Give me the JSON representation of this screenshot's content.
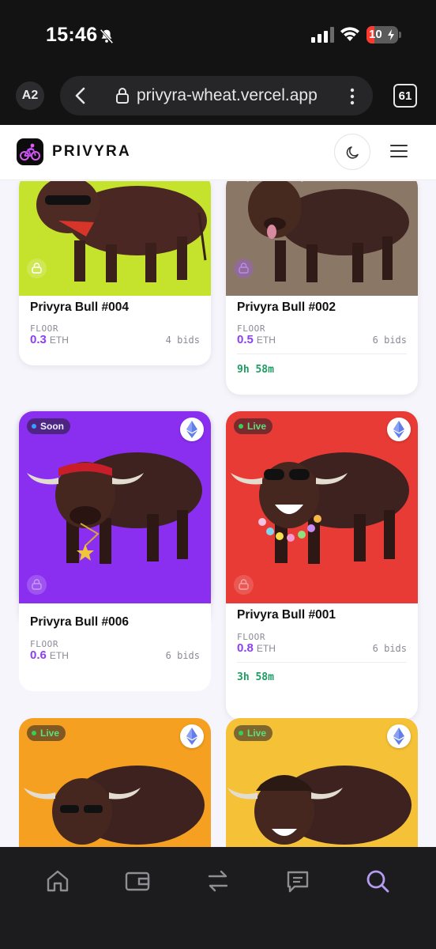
{
  "status_bar": {
    "time": "15:46",
    "battery": "10"
  },
  "browser": {
    "profile": "A2",
    "url": "privyra-wheat.vercel.app",
    "tab_count": "61"
  },
  "header": {
    "brand": "PRIVYRA"
  },
  "cards": [
    {
      "title": "Privyra Bull #004",
      "floor_label": "FLOOR",
      "floor_value": "0.3",
      "floor_unit": "ETH",
      "bids": "4 bids"
    },
    {
      "title": "Privyra Bull #002",
      "floor_label": "FLOOR",
      "floor_value": "0.5",
      "floor_unit": "ETH",
      "bids": "6 bids",
      "timer": "9h 58m"
    },
    {
      "badge": "Soon",
      "title": "Privyra Bull #006",
      "floor_label": "FLOOR",
      "floor_value": "0.6",
      "floor_unit": "ETH",
      "bids": "6 bids"
    },
    {
      "badge": "Live",
      "title": "Privyra Bull #001",
      "floor_label": "FLOOR",
      "floor_value": "0.8",
      "floor_unit": "ETH",
      "bids": "6 bids",
      "timer": "3h 58m"
    },
    {
      "badge": "Live"
    },
    {
      "badge": "Live"
    }
  ],
  "colors": {
    "card1_bg": "#c5e22c",
    "card2_bg": "#8b7766",
    "card3_bg": "#8a2ff0",
    "card4_bg": "#e83b36",
    "card5_bg": "#f5a020",
    "card6_bg": "#f4c137",
    "accent_purple": "#8b3ff0",
    "timer_green": "#1f9c63"
  },
  "bottom_nav": [
    "home-icon",
    "wallet-icon",
    "swap-icon",
    "chat-icon",
    "search-icon"
  ]
}
